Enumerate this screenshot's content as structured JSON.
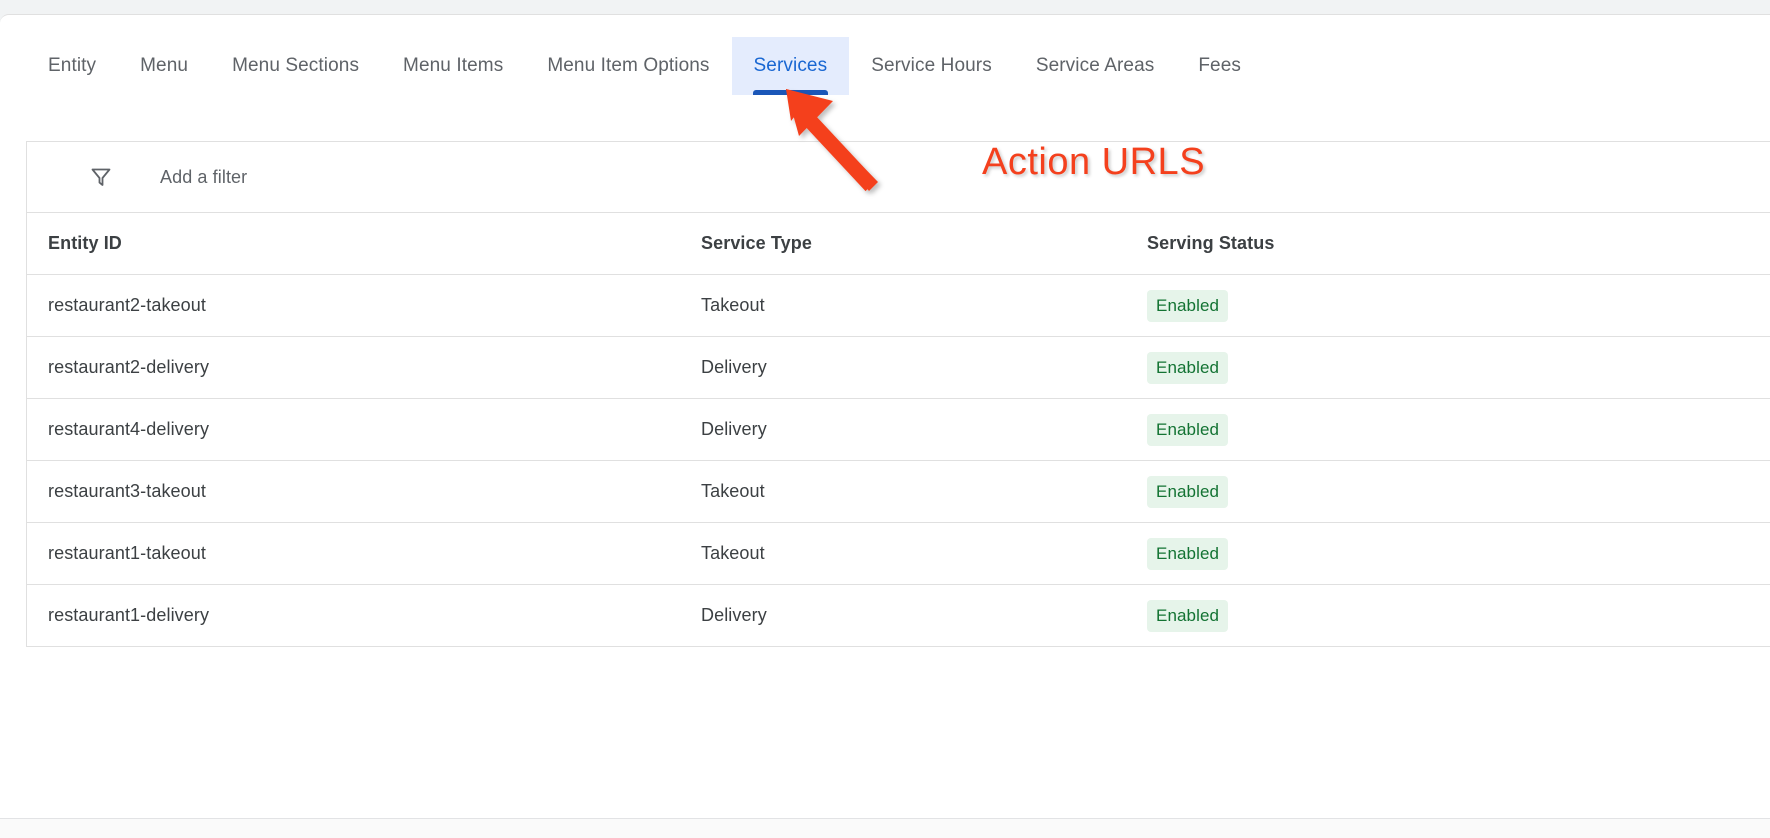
{
  "tabs": [
    {
      "label": "Entity",
      "active": false
    },
    {
      "label": "Menu",
      "active": false
    },
    {
      "label": "Menu Sections",
      "active": false
    },
    {
      "label": "Menu Items",
      "active": false
    },
    {
      "label": "Menu Item Options",
      "active": false
    },
    {
      "label": "Services",
      "active": true
    },
    {
      "label": "Service Hours",
      "active": false
    },
    {
      "label": "Service Areas",
      "active": false
    },
    {
      "label": "Fees",
      "active": false
    }
  ],
  "filter": {
    "icon": "filter-funnel-icon",
    "placeholder": "Add a filter",
    "value": ""
  },
  "table": {
    "columns": [
      "Entity ID",
      "Service Type",
      "Serving Status"
    ],
    "rows": [
      {
        "entity_id": "restaurant2-takeout",
        "service_type": "Takeout",
        "serving_status": "Enabled"
      },
      {
        "entity_id": "restaurant2-delivery",
        "service_type": "Delivery",
        "serving_status": "Enabled"
      },
      {
        "entity_id": "restaurant4-delivery",
        "service_type": "Delivery",
        "serving_status": "Enabled"
      },
      {
        "entity_id": "restaurant3-takeout",
        "service_type": "Takeout",
        "serving_status": "Enabled"
      },
      {
        "entity_id": "restaurant1-takeout",
        "service_type": "Takeout",
        "serving_status": "Enabled"
      },
      {
        "entity_id": "restaurant1-delivery",
        "service_type": "Delivery",
        "serving_status": "Enabled"
      }
    ]
  },
  "annotation": {
    "text": "Action URLS",
    "arrow_icon": "arrow-up-left-icon",
    "color": "#f4401d"
  },
  "colors": {
    "accent_blue": "#1967d2",
    "tab_active_bg": "#e4ecfd",
    "tab_underline": "#1a56b8",
    "badge_bg": "#e6f4ea",
    "badge_text": "#137333",
    "annotation": "#f4401d",
    "border": "#e0e0e0",
    "page_bg": "#f1f3f4"
  }
}
